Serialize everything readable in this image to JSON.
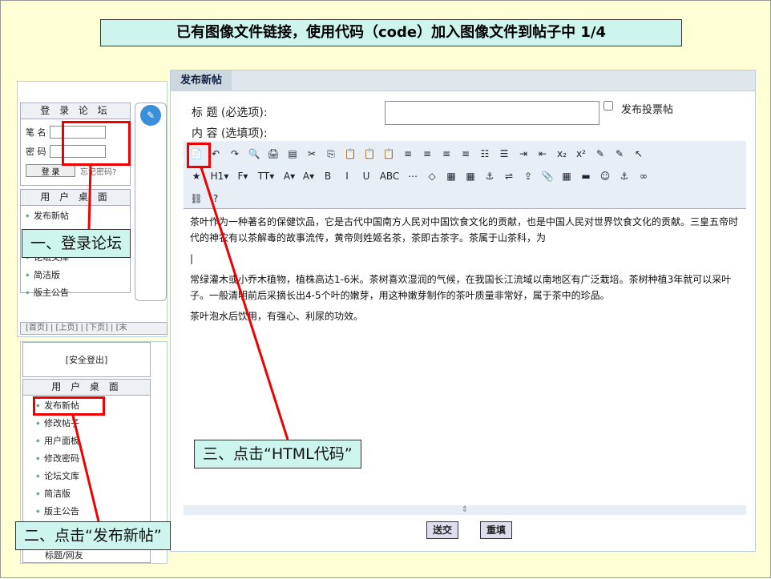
{
  "slide": {
    "title": "已有图像文件链接，使用代码（code）加入图像文件到帖子中 1/4"
  },
  "login": {
    "header": "登 录 论 坛",
    "username_label": "笔 名",
    "password_label": "密 码",
    "login_button": "登 录",
    "forgot": "忘记密码?"
  },
  "sidebar_top": {
    "items": [
      "发布新帖",
      "论坛文库",
      "简洁版",
      "版主公告"
    ],
    "header": "用 户 桌 面"
  },
  "pager": "[首页] | [上页] | [下页] | [末",
  "logout": "[安全登出]",
  "sidebar_bottom": {
    "header": "用 户 桌 面",
    "items": [
      "发布新帖",
      "修改帖子",
      "用户面板",
      "修改密码",
      "论坛文库",
      "简洁版",
      "版主公告",
      "标题/网友"
    ]
  },
  "post": {
    "tab": "发布新帖",
    "title_label": "标 题 (必选项):",
    "content_label": "内 容 (选填项):",
    "poll_label": "发布投票帖",
    "paragraphs": [
      "茶叶作为一种著名的保健饮品，它是古代中国南方人民对中国饮食文化的贡献，也是中国人民对世界饮食文化的贡献。三皇五帝时代的神农有以茶解毒的故事流传，黄帝则姓姬名茶，茶即古茶字。茶属于山茶科，为",
      "|",
      "常绿灌木或小乔木植物，植株高达1-6米。茶树喜欢湿润的气候，在我国长江流域以南地区有广泛栽培。茶树种植3年就可以采叶子。一般清明前后采摘长出4-5个叶的嫩芽，用这种嫩芽制作的茶叶质量非常好，属于茶中的珍品。",
      "茶叶泡水后饮用，有强心、利尿的功效。"
    ],
    "submit": "送交",
    "reset": "重填"
  },
  "callouts": {
    "one": "一、登录论坛",
    "two": "二、点击“发布新帖”",
    "three": "三、点击“HTML代码”"
  },
  "toolbar_row1": [
    "📄",
    "↶",
    "↷",
    "🔍",
    "🖨",
    "▤",
    "✂",
    "⎘",
    "📋",
    "📋",
    "📋",
    "≡",
    "≡",
    "≡",
    "≡",
    "☷",
    "☰",
    "⇥",
    "⇤",
    "x₂",
    "x²",
    "✎",
    "✎",
    "↖"
  ],
  "toolbar_row2": [
    "★",
    "H1▾",
    "F▾",
    "TT▾",
    "A▾",
    "A▾",
    "B",
    "I",
    "U",
    "ABC",
    "⋯",
    "◇",
    "▦",
    "▦",
    "⚓",
    "⇌",
    "⇪",
    "📎",
    "▦",
    "▬",
    "☺",
    "⚓",
    "∞"
  ],
  "toolbar_row3": [
    "⛓",
    "?"
  ]
}
